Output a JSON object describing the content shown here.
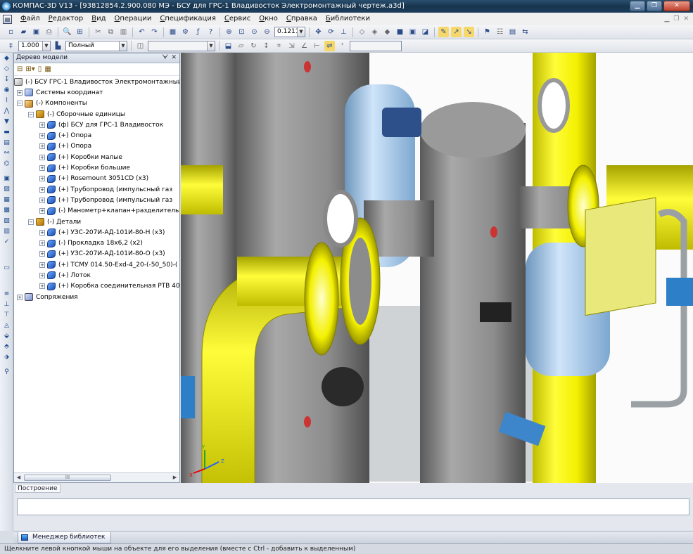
{
  "window": {
    "title": "КОМПАС-3D V13 - [93812854.2.900.080 МЭ - БСУ для ГРС-1 Владивосток Электромонтажный чертеж.a3d]",
    "controls": [
      "minimize",
      "restore",
      "close"
    ]
  },
  "menu": [
    {
      "underline": "Ф",
      "rest": "айл"
    },
    {
      "underline": "Р",
      "rest": "едактор"
    },
    {
      "underline": "В",
      "rest": "ид"
    },
    {
      "underline": "О",
      "rest": "перации"
    },
    {
      "underline": "С",
      "rest": "пецификация"
    },
    {
      "underline": "С",
      "rest": "ервис"
    },
    {
      "underline": "О",
      "rest": "кно"
    },
    {
      "underline": "С",
      "rest": "правка"
    },
    {
      "underline": "Б",
      "rest": "иблиотеки"
    }
  ],
  "toolbar": {
    "zoom_value": "0.1211",
    "scale_value": "1.000",
    "view_mode": "Полный",
    "empty_combo": ""
  },
  "tree": {
    "panel_title": "Дерево модели",
    "root": "(-) БСУ ГРС-1 Владивосток Электромонтажный",
    "items": [
      {
        "label": "Системы координат",
        "level": 1,
        "toggle": "+",
        "icon": "csys"
      },
      {
        "label": "(-) Компоненты",
        "level": 1,
        "toggle": "−",
        "icon": "comp"
      },
      {
        "label": "(-) Сборочные единицы",
        "level": 2,
        "toggle": "−",
        "icon": "asm"
      },
      {
        "label": "(ф) БСУ для ГРС-1 Владивосток",
        "level": 3,
        "toggle": "+",
        "icon": "part"
      },
      {
        "label": "(+) Опора",
        "level": 3,
        "toggle": "+",
        "icon": "part"
      },
      {
        "label": "(+) Опора",
        "level": 3,
        "toggle": "+",
        "icon": "part"
      },
      {
        "label": "(+) Коробки малые",
        "level": 3,
        "toggle": "+",
        "icon": "part"
      },
      {
        "label": "(+) Коробки большие",
        "level": 3,
        "toggle": "+",
        "icon": "part"
      },
      {
        "label": "(+) Rosemount 3051CD (x3)",
        "level": 3,
        "toggle": "+",
        "icon": "part"
      },
      {
        "label": "(+) Трубопровод  (импульсный газ",
        "level": 3,
        "toggle": "+",
        "icon": "part"
      },
      {
        "label": "(+) Трубопровод  (импульсный газ",
        "level": 3,
        "toggle": "+",
        "icon": "part"
      },
      {
        "label": "(-) Манометр+клапан+разделитель",
        "level": 3,
        "toggle": "+",
        "icon": "part"
      },
      {
        "label": "(-) Детали",
        "level": 2,
        "toggle": "−",
        "icon": "asm"
      },
      {
        "label": "(+) УЗС-207И-АД-101И-80-Н (x3)",
        "level": 3,
        "toggle": "+",
        "icon": "part"
      },
      {
        "label": "(-) Прокладка 18х6,2 (x2)",
        "level": 3,
        "toggle": "+",
        "icon": "part"
      },
      {
        "label": "(+) УЗС-207И-АД-101И-80-О (x3)",
        "level": 3,
        "toggle": "+",
        "icon": "part"
      },
      {
        "label": "(+) ТСМУ 014.50-Exd-4_20-(-50_50)-(",
        "level": 3,
        "toggle": "+",
        "icon": "part"
      },
      {
        "label": "(+) Лоток",
        "level": 3,
        "toggle": "+",
        "icon": "part"
      },
      {
        "label": "(+) Коробка соединительная РТВ 40",
        "level": 3,
        "toggle": "+",
        "icon": "part"
      },
      {
        "label": "Сопряжения",
        "level": 1,
        "toggle": "+",
        "icon": "mate"
      }
    ],
    "scroll_thumb_text": "III"
  },
  "bottom": {
    "build_label": "Построение",
    "library_tab": "Менеджер библиотек"
  },
  "status": {
    "text": "Щелкните левой кнопкой мыши на объекте для его выделения (вместе с Ctrl - добавить к выделенным)"
  },
  "axes": {
    "x": "X",
    "y": "Y",
    "z": "Z"
  },
  "colors": {
    "pipe_yellow": "#f3f000",
    "vessel_gray": "#8c8c8c",
    "housing_blue": "#a9cdee",
    "titlebar": "#1d3e5c"
  }
}
